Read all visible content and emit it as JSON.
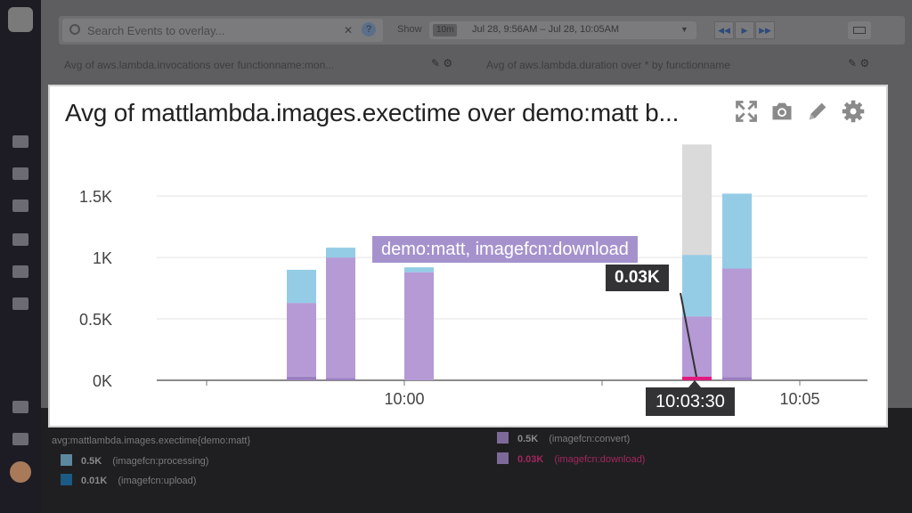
{
  "search": {
    "placeholder": "Search Events to overlay..."
  },
  "timeframe": {
    "show_label": "Show",
    "preset": "10m",
    "range": "Jul 28, 9:56AM – Jul 28, 10:05AM"
  },
  "background_widgets": [
    {
      "title": "Avg of aws.lambda.invocations over functionname:mon..."
    },
    {
      "title": "Avg of aws.lambda.duration over * by functionname"
    }
  ],
  "widget": {
    "title": "Avg of mattlambda.images.exectime over demo:matt b...",
    "tools": [
      "expand-icon",
      "camera-icon",
      "pencil-icon",
      "gear-icon"
    ]
  },
  "tooltip": {
    "series": "demo:matt, imagefcn:download",
    "value": "0.03K",
    "time": "10:03:30"
  },
  "legend": {
    "title": "avg:mattlambda.images.exectime{demo:matt}",
    "items": [
      {
        "value": "0.5K",
        "name": "(imagefcn:processing)",
        "color": "#7fb4d8"
      },
      {
        "value": "0.01K",
        "name": "(imagefcn:upload)",
        "color": "#1f6fa8"
      },
      {
        "value": "0.5K",
        "name": "(imagefcn:convert)",
        "color": "#a98fcf"
      },
      {
        "value": "0.03K",
        "name": "(imagefcn:download)",
        "color": "#e2197f"
      }
    ]
  },
  "chart_data": {
    "type": "bar",
    "stacked": true,
    "x_tick_labels": [
      "10:00",
      "10:05"
    ],
    "y_tick_labels": [
      "0K",
      "0.5K",
      "1K",
      "1.5K"
    ],
    "ylim": [
      0,
      1900
    ],
    "grid": true,
    "bars": [
      {
        "download": 30,
        "convert": 600,
        "processing": 270,
        "upload": 0
      },
      {
        "download": 20,
        "convert": 980,
        "processing": 80,
        "upload": 0
      },
      {
        "download": 0,
        "convert": 880,
        "processing": 40,
        "upload": 0
      },
      {
        "download": 30,
        "convert": 490,
        "processing": 500,
        "upload": 0,
        "highlight": 900
      },
      {
        "download": 25,
        "convert": 885,
        "processing": 610,
        "upload": 0
      }
    ],
    "colors": {
      "convert": "#b59ad6",
      "processing": "#94cce6",
      "download": "#e2197f",
      "highlight": "#dadada"
    }
  }
}
